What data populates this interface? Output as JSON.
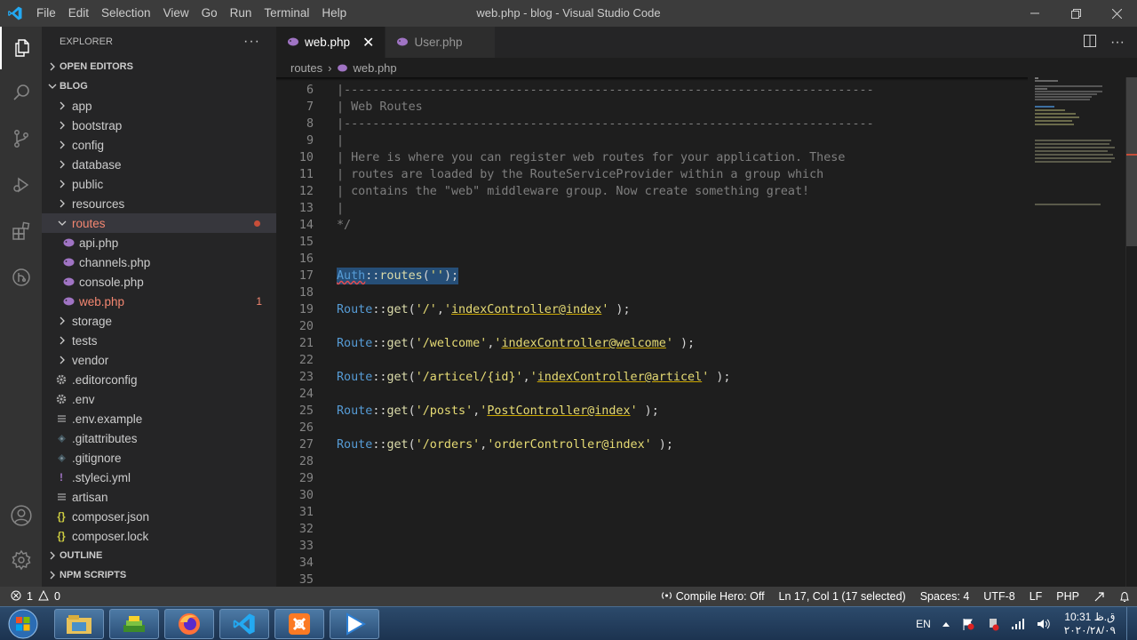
{
  "window": {
    "title": "web.php - blog - Visual Studio Code",
    "menu": [
      "File",
      "Edit",
      "Selection",
      "View",
      "Go",
      "Run",
      "Terminal",
      "Help"
    ]
  },
  "sidebar": {
    "title": "EXPLORER",
    "more": "···",
    "open_editors": "OPEN EDITORS",
    "project": "BLOG",
    "items": [
      {
        "label": "app",
        "type": "folder"
      },
      {
        "label": "bootstrap",
        "type": "folder"
      },
      {
        "label": "config",
        "type": "folder"
      },
      {
        "label": "database",
        "type": "folder"
      },
      {
        "label": "public",
        "type": "folder"
      },
      {
        "label": "resources",
        "type": "folder"
      },
      {
        "label": "routes",
        "type": "folder-open"
      },
      {
        "label": "api.php",
        "type": "php"
      },
      {
        "label": "channels.php",
        "type": "php"
      },
      {
        "label": "console.php",
        "type": "php"
      },
      {
        "label": "web.php",
        "type": "php",
        "badge": "1"
      },
      {
        "label": "storage",
        "type": "folder"
      },
      {
        "label": "tests",
        "type": "folder"
      },
      {
        "label": "vendor",
        "type": "folder"
      },
      {
        "label": ".editorconfig",
        "type": "gear"
      },
      {
        "label": ".env",
        "type": "gear"
      },
      {
        "label": ".env.example",
        "type": "lines"
      },
      {
        "label": ".gitattributes",
        "type": "git"
      },
      {
        "label": ".gitignore",
        "type": "git"
      },
      {
        "label": ".styleci.yml",
        "type": "yml"
      },
      {
        "label": "artisan",
        "type": "lines"
      },
      {
        "label": "composer.json",
        "type": "json"
      },
      {
        "label": "composer.lock",
        "type": "json"
      }
    ],
    "outline": "OUTLINE",
    "npm_scripts": "NPM SCRIPTS"
  },
  "tabs": [
    {
      "label": "web.php",
      "close": "✕",
      "active": true
    },
    {
      "label": "User.php",
      "active": false
    }
  ],
  "breadcrumb": {
    "folder": "routes",
    "sep": "›",
    "file": "web.php"
  },
  "code": {
    "lines": [
      {
        "n": "6",
        "parts": [
          {
            "c": "cmt",
            "t": "|--------------------------------------------------------------------------"
          }
        ]
      },
      {
        "n": "7",
        "parts": [
          {
            "c": "cmt",
            "t": "| Web Routes"
          }
        ]
      },
      {
        "n": "8",
        "parts": [
          {
            "c": "cmt",
            "t": "|--------------------------------------------------------------------------"
          }
        ]
      },
      {
        "n": "9",
        "parts": [
          {
            "c": "cmt",
            "t": "|"
          }
        ]
      },
      {
        "n": "10",
        "parts": [
          {
            "c": "cmt",
            "t": "| Here is where you can register web routes for your application. These"
          }
        ]
      },
      {
        "n": "11",
        "parts": [
          {
            "c": "cmt",
            "t": "| routes are loaded by the RouteServiceProvider within a group which"
          }
        ]
      },
      {
        "n": "12",
        "parts": [
          {
            "c": "cmt",
            "t": "| contains the \"web\" middleware group. Now create something great!"
          }
        ]
      },
      {
        "n": "13",
        "parts": [
          {
            "c": "cmt",
            "t": "|"
          }
        ]
      },
      {
        "n": "14",
        "parts": [
          {
            "c": "cmt",
            "t": "*/"
          }
        ]
      },
      {
        "n": "15",
        "parts": []
      },
      {
        "n": "16",
        "parts": []
      },
      {
        "n": "17",
        "selected": true,
        "parts": [
          {
            "c": "cls squig",
            "t": "Auth"
          },
          {
            "c": "op",
            "t": "::"
          },
          {
            "c": "fn",
            "t": "routes"
          },
          {
            "c": "punc",
            "t": "("
          },
          {
            "c": "str",
            "t": "''"
          },
          {
            "c": "punc",
            "t": ");"
          }
        ]
      },
      {
        "n": "18",
        "parts": []
      },
      {
        "n": "19",
        "parts": [
          {
            "c": "cls",
            "t": "Route"
          },
          {
            "c": "op",
            "t": "::"
          },
          {
            "c": "fn",
            "t": "get"
          },
          {
            "c": "punc",
            "t": "("
          },
          {
            "c": "str",
            "t": "'/'"
          },
          {
            "c": "punc",
            "t": ","
          },
          {
            "c": "str",
            "t": "'"
          },
          {
            "c": "str uline",
            "t": "indexController@index"
          },
          {
            "c": "str",
            "t": "'"
          },
          {
            "c": "punc",
            "t": " );"
          }
        ]
      },
      {
        "n": "20",
        "parts": []
      },
      {
        "n": "21",
        "parts": [
          {
            "c": "cls",
            "t": "Route"
          },
          {
            "c": "op",
            "t": "::"
          },
          {
            "c": "fn",
            "t": "get"
          },
          {
            "c": "punc",
            "t": "("
          },
          {
            "c": "str",
            "t": "'/welcome'"
          },
          {
            "c": "punc",
            "t": ","
          },
          {
            "c": "str",
            "t": "'"
          },
          {
            "c": "str uline",
            "t": "indexController@welcome"
          },
          {
            "c": "str",
            "t": "'"
          },
          {
            "c": "punc",
            "t": " );"
          }
        ]
      },
      {
        "n": "22",
        "parts": []
      },
      {
        "n": "23",
        "parts": [
          {
            "c": "cls",
            "t": "Route"
          },
          {
            "c": "op",
            "t": "::"
          },
          {
            "c": "fn",
            "t": "get"
          },
          {
            "c": "punc",
            "t": "("
          },
          {
            "c": "str",
            "t": "'/articel/{id}'"
          },
          {
            "c": "punc",
            "t": ","
          },
          {
            "c": "str",
            "t": "'"
          },
          {
            "c": "str uline",
            "t": "indexController@articel"
          },
          {
            "c": "str",
            "t": "'"
          },
          {
            "c": "punc",
            "t": " );"
          }
        ]
      },
      {
        "n": "24",
        "parts": []
      },
      {
        "n": "25",
        "parts": [
          {
            "c": "cls",
            "t": "Route"
          },
          {
            "c": "op",
            "t": "::"
          },
          {
            "c": "fn",
            "t": "get"
          },
          {
            "c": "punc",
            "t": "("
          },
          {
            "c": "str",
            "t": "'/posts'"
          },
          {
            "c": "punc",
            "t": ","
          },
          {
            "c": "str",
            "t": "'"
          },
          {
            "c": "str uline",
            "t": "PostController@index"
          },
          {
            "c": "str",
            "t": "'"
          },
          {
            "c": "punc",
            "t": " );"
          }
        ]
      },
      {
        "n": "26",
        "parts": []
      },
      {
        "n": "27",
        "parts": [
          {
            "c": "cls",
            "t": "Route"
          },
          {
            "c": "op",
            "t": "::"
          },
          {
            "c": "fn",
            "t": "get"
          },
          {
            "c": "punc",
            "t": "("
          },
          {
            "c": "str",
            "t": "'/orders'"
          },
          {
            "c": "punc",
            "t": ","
          },
          {
            "c": "str",
            "t": "'orderController@index'"
          },
          {
            "c": "punc",
            "t": " );"
          }
        ]
      },
      {
        "n": "28",
        "parts": []
      },
      {
        "n": "29",
        "parts": []
      },
      {
        "n": "30",
        "parts": []
      },
      {
        "n": "31",
        "parts": []
      },
      {
        "n": "32",
        "parts": []
      },
      {
        "n": "33",
        "parts": []
      },
      {
        "n": "34",
        "parts": []
      },
      {
        "n": "35",
        "parts": []
      }
    ]
  },
  "statusbar": {
    "errors": "1",
    "warnings": "0",
    "compile_hero": "Compile Hero: Off",
    "position": "Ln 17, Col 1 (17 selected)",
    "spaces": "Spaces: 4",
    "encoding": "UTF-8",
    "eol": "LF",
    "language": "PHP"
  },
  "taskbar": {
    "language": "EN",
    "time": "10:31 ق.ظ",
    "date": "۲۰۲۰/۲۸/۰۹"
  },
  "colors": {
    "accent": "#007acc",
    "error": "#f48771",
    "php": "#a074c4"
  }
}
